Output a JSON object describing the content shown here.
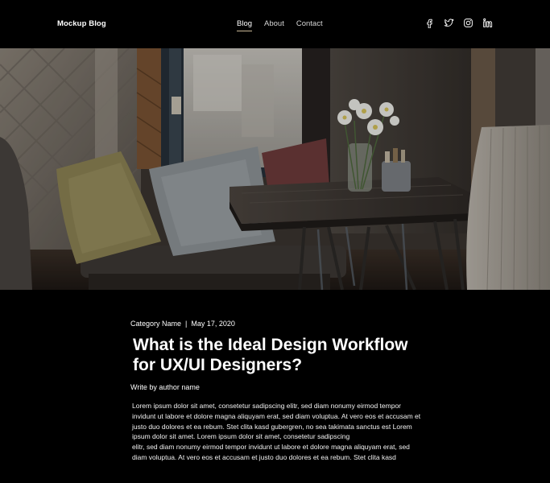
{
  "header": {
    "brand": "Mockup Blog",
    "nav": [
      {
        "label": "Blog",
        "active": true
      },
      {
        "label": "About",
        "active": false
      },
      {
        "label": "Contact",
        "active": false
      }
    ],
    "socials": [
      "facebook-icon",
      "twitter-icon",
      "instagram-icon",
      "linkedin-icon"
    ]
  },
  "hero": {
    "image": "cafe interior with cushioned bench, wooden table and flowers in a vase"
  },
  "article": {
    "category": "Category Name",
    "separator": "|",
    "date": "May 17, 2020",
    "title_line1": "What is the Ideal Design Workflow",
    "title_line2": "for UX/UI Designers?",
    "author": "Write by author name",
    "paragraph1": "Lorem ipsum dolor sit amet, consetetur sadipscing elitr, sed diam nonumy eirmod tempor invidunt ut labore et dolore magna aliquyam erat, sed diam voluptua. At vero eos et accusam et justo duo dolores et ea rebum. Stet clita kasd gubergren, no sea takimata sanctus est Lorem ipsum dolor sit amet. Lorem ipsum dolor sit amet, consetetur sadipscing",
    "paragraph2": "elitr, sed diam nonumy eirmod tempor invidunt ut labore et dolore magna aliquyam erat, sed diam voluptua. At vero eos et accusam et justo duo dolores et ea rebum. Stet clita kasd"
  },
  "colors": {
    "background": "#000000",
    "nav_active_underline": "#c9b896",
    "text": "#ffffff"
  }
}
